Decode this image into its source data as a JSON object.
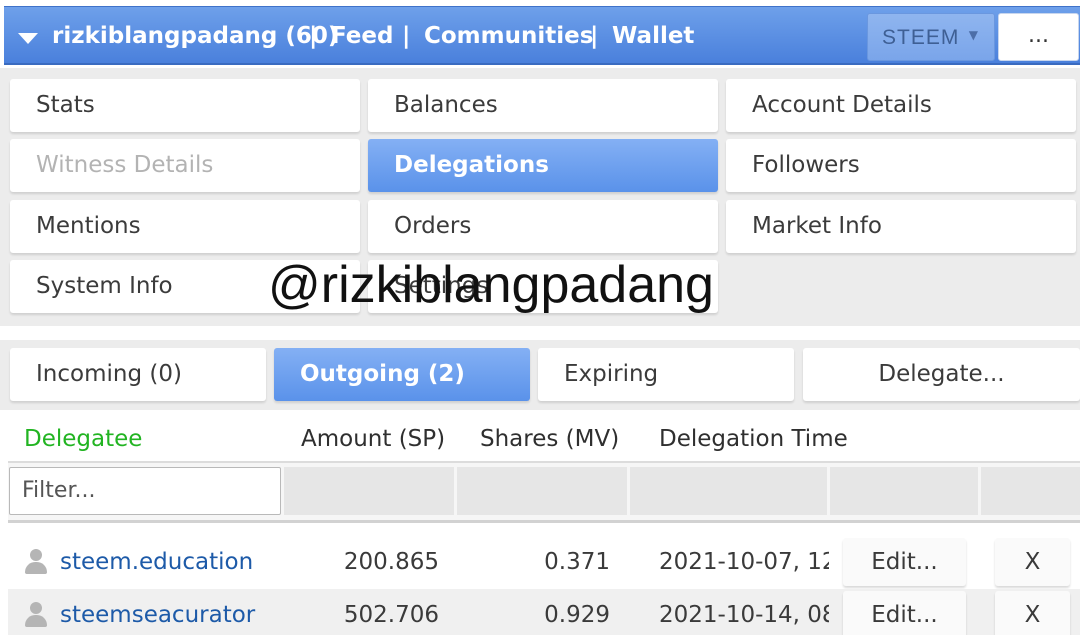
{
  "topbar": {
    "account": "rizkiblangpadang (60)",
    "nav": [
      "Feed",
      "Communities",
      "Wallet"
    ],
    "separator": "|",
    "chain_select": "STEEM",
    "more": "...",
    "colors": {
      "bar": "#5a8de2",
      "text": "#ffffff"
    }
  },
  "menu": {
    "items": [
      {
        "label": "Stats",
        "state": "normal"
      },
      {
        "label": "Balances",
        "state": "normal"
      },
      {
        "label": "Account Details",
        "state": "normal"
      },
      {
        "label": "Witness Details",
        "state": "disabled"
      },
      {
        "label": "Delegations",
        "state": "active"
      },
      {
        "label": "Followers",
        "state": "normal"
      },
      {
        "label": "Mentions",
        "state": "normal"
      },
      {
        "label": "Orders",
        "state": "normal"
      },
      {
        "label": "Market Info",
        "state": "normal"
      },
      {
        "label": "System Info",
        "state": "normal"
      },
      {
        "label": "Settings",
        "state": "normal"
      }
    ]
  },
  "watermark": "@rizkiblangpadang",
  "tabs": [
    {
      "label": "Incoming (0)",
      "active": false
    },
    {
      "label": "Outgoing (2)",
      "active": true
    },
    {
      "label": "Expiring",
      "active": false
    },
    {
      "label": "Delegate...",
      "active": false
    }
  ],
  "table": {
    "columns": [
      "Delegatee",
      "Amount (SP)",
      "Shares (MV)",
      "Delegation Time"
    ],
    "filter_placeholder": "Filter...",
    "rows": [
      {
        "delegatee": "steem.education",
        "amount": "200.865",
        "shares": "0.371",
        "time": "2021-10-07, 12:",
        "edit": "Edit...",
        "remove": "X"
      },
      {
        "delegatee": "steemseacurator",
        "amount": "502.706",
        "shares": "0.929",
        "time": "2021-10-14, 08:",
        "edit": "Edit...",
        "remove": "X"
      }
    ]
  },
  "colors": {
    "active": "#6a9ff0",
    "delegatee_header": "#22b422",
    "link": "#1d5aa8"
  }
}
